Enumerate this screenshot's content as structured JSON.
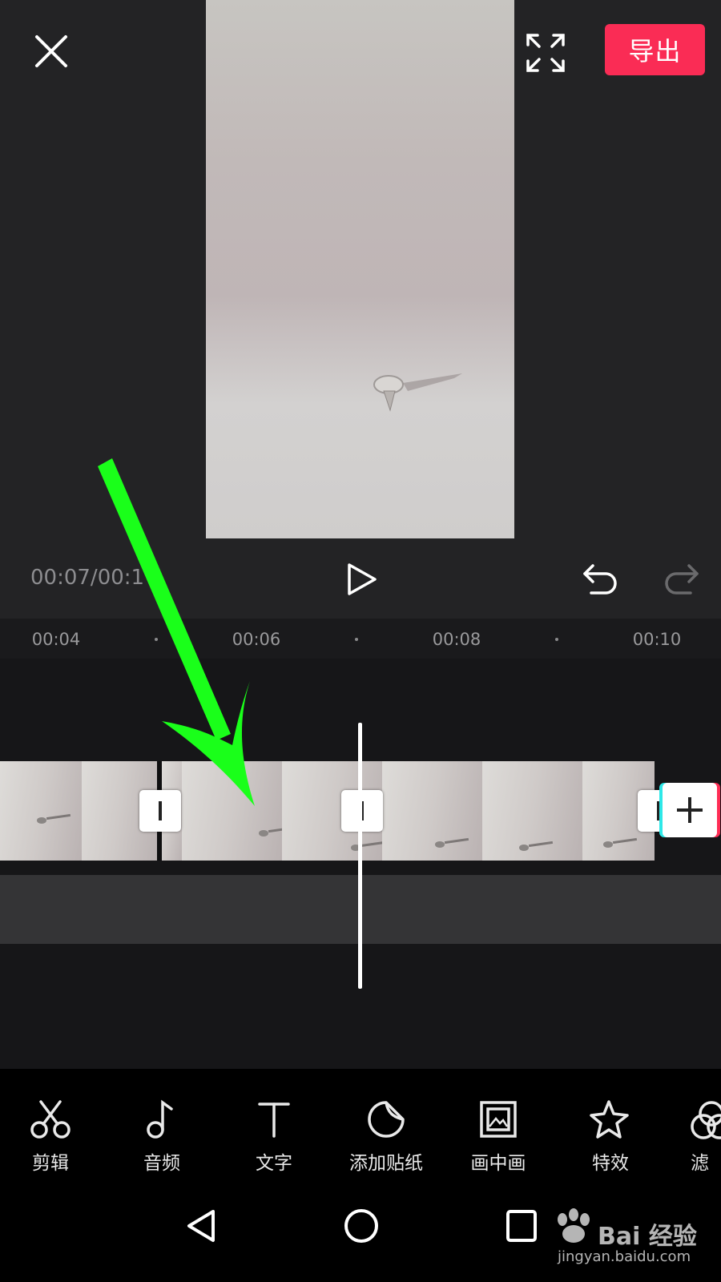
{
  "header": {
    "close_icon": "close-icon",
    "fullscreen_icon": "fullscreen-icon",
    "export_label": "导出",
    "export_color": "#fa2c55"
  },
  "player": {
    "timecode": "00:07/00:1",
    "play_icon": "play-icon",
    "undo_icon": "undo-icon",
    "redo_icon": "redo-icon"
  },
  "ruler": {
    "ticks": [
      "00:04",
      "00:06",
      "00:08",
      "00:10"
    ]
  },
  "timeline": {
    "add_icon": "plus-icon"
  },
  "toolbar": {
    "items": [
      {
        "label": "剪辑",
        "icon": "scissors-icon"
      },
      {
        "label": "音频",
        "icon": "music-note-icon"
      },
      {
        "label": "文字",
        "icon": "text-icon"
      },
      {
        "label": "添加贴纸",
        "icon": "sticker-icon"
      },
      {
        "label": "画中画",
        "icon": "picture-in-picture-icon"
      },
      {
        "label": "特效",
        "icon": "effects-star-icon"
      },
      {
        "label": "滤",
        "icon": "filter-icon"
      }
    ]
  },
  "navbar": {
    "back_icon": "back-triangle-icon",
    "home_icon": "home-circle-icon",
    "recents_icon": "recents-square-icon"
  },
  "watermark": {
    "brand": "Bai 经验",
    "url": "jingyan.baidu.com"
  },
  "annotation": {
    "arrow_color": "#1aff1a"
  }
}
